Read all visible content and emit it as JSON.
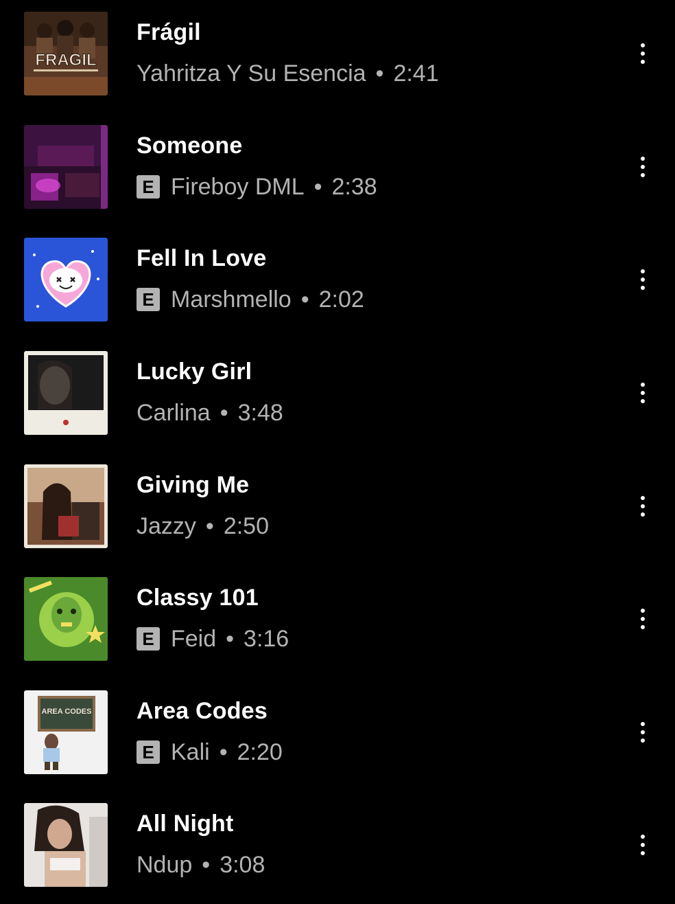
{
  "tracks": [
    {
      "title": "Frágil",
      "artist": "Yahritza Y Su Esencia",
      "duration": "2:41",
      "explicit": false,
      "art_text": "FRAGIL",
      "art_icon": "album-art-fragil"
    },
    {
      "title": "Someone",
      "artist": "Fireboy DML",
      "duration": "2:38",
      "explicit": true,
      "art_icon": "album-art-someone"
    },
    {
      "title": "Fell In Love",
      "artist": "Marshmello",
      "duration": "2:02",
      "explicit": true,
      "art_icon": "album-art-fell-in-love"
    },
    {
      "title": "Lucky Girl",
      "artist": "Carlina",
      "duration": "3:48",
      "explicit": false,
      "art_icon": "album-art-lucky-girl"
    },
    {
      "title": "Giving Me",
      "artist": "Jazzy",
      "duration": "2:50",
      "explicit": false,
      "art_icon": "album-art-giving-me"
    },
    {
      "title": "Classy 101",
      "artist": "Feid",
      "duration": "3:16",
      "explicit": true,
      "art_icon": "album-art-classy-101"
    },
    {
      "title": "Area Codes",
      "artist": "Kali",
      "duration": "2:20",
      "explicit": true,
      "art_text": "AREA CODES",
      "art_icon": "album-art-area-codes"
    },
    {
      "title": "All Night",
      "artist": "Ndup",
      "duration": "3:08",
      "explicit": false,
      "art_icon": "album-art-all-night"
    }
  ],
  "explicit_label": "E",
  "separator": "•",
  "more_icon": "more-vertical-icon"
}
